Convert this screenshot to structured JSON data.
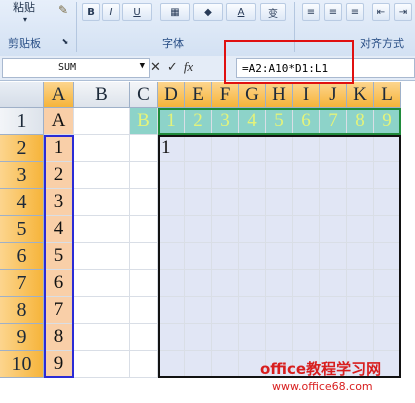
{
  "ribbon": {
    "paste_label": "粘贴",
    "clipboard_group": "剪贴板",
    "font_group": "字体",
    "align_group": "对齐方式",
    "bold": "B",
    "italic": "I",
    "underline": "U",
    "font_color": "A",
    "phonetic": "变"
  },
  "formula_bar": {
    "name_box": "SUM",
    "cancel_icon": "✕",
    "enter_icon": "✓",
    "fx_icon": "fx",
    "formula": "=A2:A10*D1:L1"
  },
  "columns": [
    "A",
    "B",
    "C",
    "D",
    "E",
    "F",
    "G",
    "H",
    "I",
    "J",
    "K",
    "L"
  ],
  "rows": [
    "1",
    "2",
    "3",
    "4",
    "5",
    "6",
    "7",
    "8",
    "9",
    "10"
  ],
  "cells": {
    "A1": "A",
    "C1": "B",
    "row1_values": [
      "1",
      "2",
      "3",
      "4",
      "5",
      "6",
      "7",
      "8",
      "9"
    ],
    "colA_values": [
      "1",
      "2",
      "3",
      "4",
      "5",
      "6",
      "7",
      "8",
      "9"
    ],
    "D2": "1"
  },
  "watermark": {
    "line1": "office教程学习网",
    "line2": "www.office68.com"
  }
}
